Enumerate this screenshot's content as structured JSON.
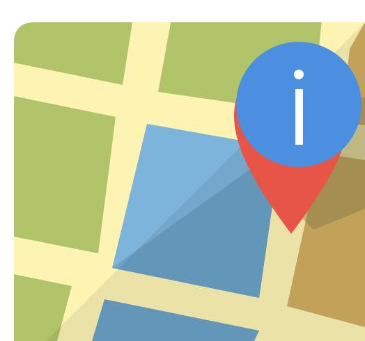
{
  "icon": {
    "name": "map-info-pin-icon",
    "info_glyph": "i"
  },
  "colors": {
    "background": "#ffffff",
    "park_green": "#b2c46a",
    "road_cream": "#fdf4b4",
    "road_shadow": "#ede49e",
    "water_blue_light": "#7cb4dc",
    "water_blue_dark": "#6ba3c8",
    "ground_tan": "#d1af60",
    "ground_tan_shadow": "#b69c58",
    "pin_red": "#e65545",
    "pin_circle_blue": "#4a8fe0",
    "info_glyph_white": "#ffffff"
  }
}
